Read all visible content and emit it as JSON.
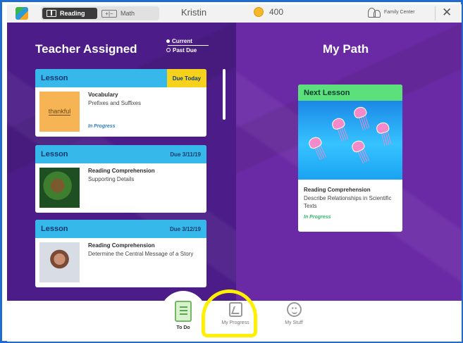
{
  "header": {
    "subjects": [
      {
        "label": "Reading",
        "icon": "book-icon",
        "selected": true
      },
      {
        "label": "Math",
        "icon": "math-icon",
        "selected": false
      }
    ],
    "user_name": "Kristin",
    "coins": "400",
    "family_center": "Family Center",
    "close": "✕"
  },
  "teacher_assigned": {
    "title": "Teacher Assigned",
    "filters": [
      "Current",
      "Past Due"
    ],
    "cards": [
      {
        "type": "Lesson",
        "due": "Due Today",
        "thumbnail_text": "thankful",
        "subject": "Vocabulary",
        "topic": "Prefixes and Suffixes",
        "status": "In Progress"
      },
      {
        "type": "Lesson",
        "due": "Due 3/11/19",
        "subject": "Reading Comprehension",
        "topic": "Supporting Details",
        "status": ""
      },
      {
        "type": "Lesson",
        "due": "Due 3/12/19",
        "subject": "Reading Comprehension",
        "topic": "Determine the Central Message of a Story",
        "status": ""
      }
    ]
  },
  "my_path": {
    "title": "My Path",
    "next_lesson": {
      "label": "Next Lesson",
      "subject": "Reading Comprehension",
      "topic": "Describe Relationships in Scientific Texts",
      "status": "In Progress"
    }
  },
  "bottom_nav": [
    {
      "label": "To Do",
      "icon": "clipboard-icon"
    },
    {
      "label": "My Progress",
      "icon": "chart-icon"
    },
    {
      "label": "My Stuff",
      "icon": "smile-icon"
    }
  ],
  "colors": {
    "left_panel": "#4c1d88",
    "right_panel": "#6b2aa5",
    "lesson_header": "#37b8ea",
    "due_today": "#f7d21d",
    "next_lesson": "#5be07b",
    "highlight": "#ffef00"
  }
}
